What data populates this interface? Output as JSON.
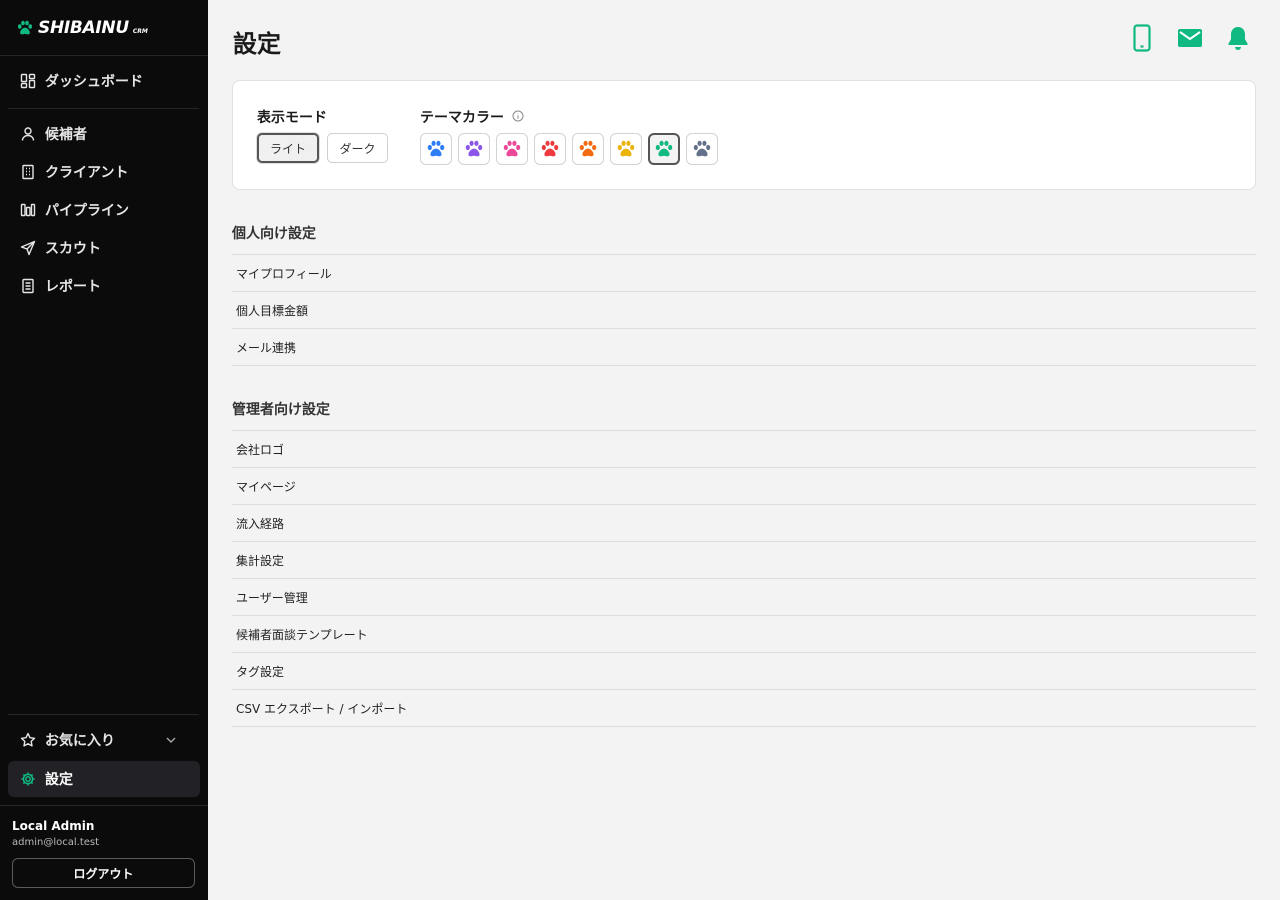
{
  "brand": {
    "name": "SHIBAINU",
    "sub": "CRM"
  },
  "sidebar": {
    "dashboard": "ダッシュボード",
    "items": [
      "候補者",
      "クライアント",
      "パイプライン",
      "スカウト",
      "レポート"
    ],
    "favorites": "お気に入り",
    "settings": "設定"
  },
  "user": {
    "name": "Local Admin",
    "email": "admin@local.test",
    "logout": "ログアウト"
  },
  "page": {
    "title": "設定"
  },
  "display": {
    "mode_label": "表示モード",
    "light": "ライト",
    "dark": "ダーク",
    "selected_mode": "ライト",
    "theme_label": "テーマカラー",
    "theme_colors": [
      "#2f7df6",
      "#8b55e8",
      "#ec4899",
      "#ef3a3f",
      "#f26a12",
      "#eab308",
      "#10b981",
      "#64718a"
    ],
    "selected_color": "#10b981"
  },
  "personal": {
    "title": "個人向け設定",
    "items": [
      "マイプロフィール",
      "個人目標金額",
      "メール連携"
    ]
  },
  "admin": {
    "title": "管理者向け設定",
    "items": [
      "会社ロゴ",
      "マイページ",
      "流入経路",
      "集計設定",
      "ユーザー管理",
      "候補者面談テンプレート",
      "タグ設定",
      "CSV エクスポート / インポート"
    ]
  },
  "colors": {
    "accent": "#10b981",
    "sidebar_bg": "#0b0b0c"
  },
  "icons": [
    "paw-icon",
    "dashboard-icon",
    "user-icon",
    "building-icon",
    "pipeline-icon",
    "send-icon",
    "report-icon",
    "star-icon",
    "chevron-down-icon",
    "gear-icon",
    "phone-icon",
    "mail-icon",
    "bell-icon",
    "info-icon"
  ]
}
